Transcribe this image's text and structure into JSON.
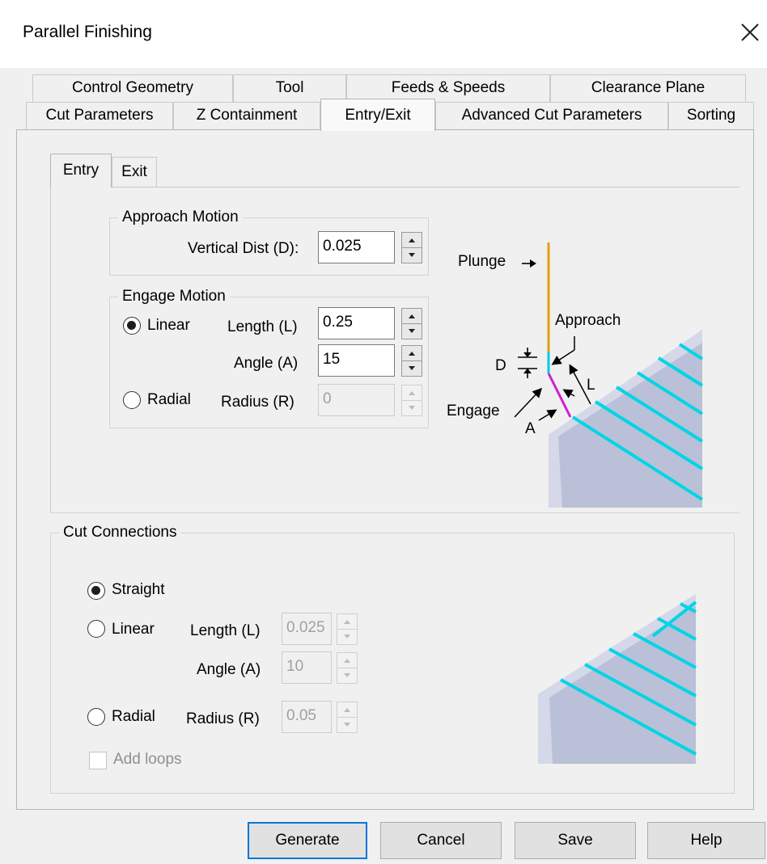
{
  "window": {
    "title": "Parallel Finishing",
    "close_glyph": "✕"
  },
  "tabs": {
    "back_row": [
      "Control Geometry",
      "Tool",
      "Feeds & Speeds",
      "Clearance Plane"
    ],
    "front_row": [
      "Cut Parameters",
      "Z Containment",
      "Entry/Exit",
      "Advanced Cut Parameters",
      "Sorting"
    ],
    "active": "Entry/Exit"
  },
  "subtabs": {
    "entry": "Entry",
    "exit": "Exit",
    "active": "Entry"
  },
  "approach": {
    "group_label": "Approach Motion",
    "vertical_dist_label": "Vertical Dist (D):",
    "vertical_dist_value": "0.025"
  },
  "engage": {
    "group_label": "Engage Motion",
    "linear_label": "Linear",
    "radial_label": "Radial",
    "length_label": "Length (L)",
    "length_value": "0.25",
    "angle_label": "Angle (A)",
    "angle_value": "15",
    "radius_label": "Radius (R)",
    "radius_value": "0",
    "selected": "Linear"
  },
  "diagram_entry": {
    "plunge": "Plunge",
    "approach": "Approach",
    "d": "D",
    "l": "L",
    "engage": "Engage",
    "a": "A",
    "colors": {
      "plunge_line": "#e3a008",
      "engage_line": "#d020d0",
      "approach_line": "#00c8e0",
      "stripe": "#00d5e5"
    }
  },
  "cut_connections": {
    "group_label": "Cut Connections",
    "straight_label": "Straight",
    "linear_label": "Linear",
    "radial_label": "Radial",
    "length_label": "Length (L)",
    "length_value": "0.025",
    "angle_label": "Angle (A)",
    "angle_value": "10",
    "radius_label": "Radius (R)",
    "radius_value": "0.05",
    "add_loops_label": "Add loops",
    "selected": "Straight"
  },
  "buttons": {
    "generate": "Generate",
    "cancel": "Cancel",
    "save": "Save",
    "help": "Help"
  }
}
